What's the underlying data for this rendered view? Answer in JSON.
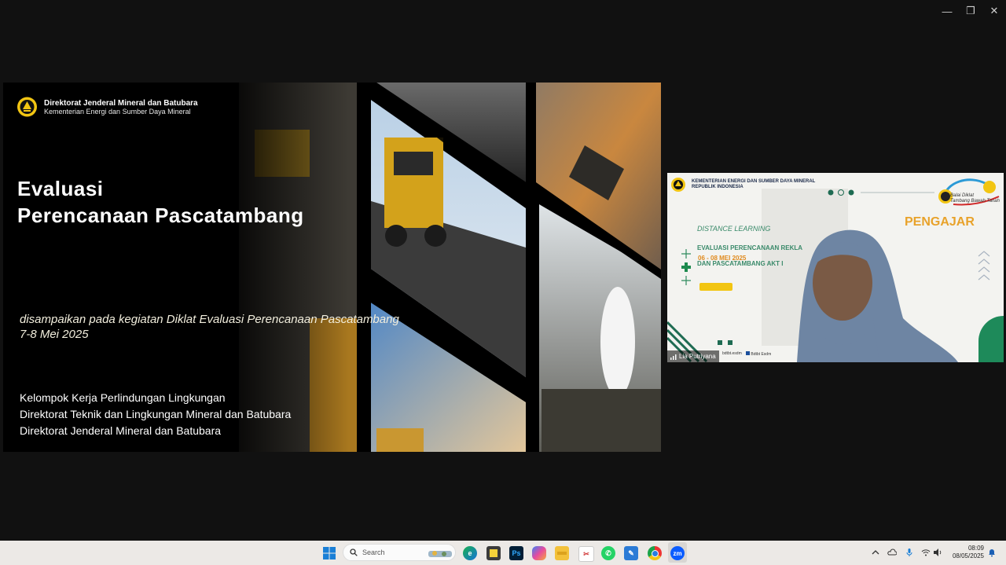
{
  "window_controls": {
    "minimize": "—",
    "restore": "❐",
    "close": "✕"
  },
  "slide": {
    "org_line1": "Direktorat Jenderal Mineral dan Batubara",
    "org_line2": "Kementerian Energi dan Sumber Daya Mineral",
    "title_line1": "Evaluasi",
    "title_line2": "Perencanaan Pascatambang",
    "subtitle_line1": "disampaikan pada kegiatan Diklat Evaluasi Perencanaan Pascatambang",
    "subtitle_line2": "7-8 Mei 2025",
    "footer_line1": "Kelompok Kerja Perlindungan Lingkungan",
    "footer_line2": "Direktorat Teknik dan Lingkungan Mineral dan Batubara",
    "footer_line3": "Direktorat Jenderal Mineral dan Batubara"
  },
  "video": {
    "ministry_line1": "KEMENTERIAN ENERGI DAN SUMBER DAYA MINERAL",
    "ministry_line2": "REPUBLIK INDONESIA",
    "distance_learning": "DISTANCE LEARNING",
    "course_line1": "EVALUASI PERENCANAAN REKLA",
    "course_line2": "DAN PASCATAMBANG AKT I",
    "date": "06 - 08 MEI 2025",
    "pengajar": "PENGAJAR",
    "brand_line1": "Balai Diklat",
    "brand_line2": "Tambang Bawah Tanah",
    "participant_name": "Lia Putriyana",
    "social1": "bdtbt.esdm",
    "social2": "Bdtbt Esdm"
  },
  "taskbar": {
    "search_placeholder": "Search",
    "apps": [
      "edge-icon",
      "sticky-notes-icon",
      "photoshop-icon",
      "copilot-icon",
      "file-explorer-icon",
      "snipping-tool-icon",
      "whatsapp-icon",
      "paint-icon",
      "chrome-icon",
      "zoom-icon"
    ],
    "clock_time": "08:09",
    "clock_date": "08/05/2025"
  }
}
